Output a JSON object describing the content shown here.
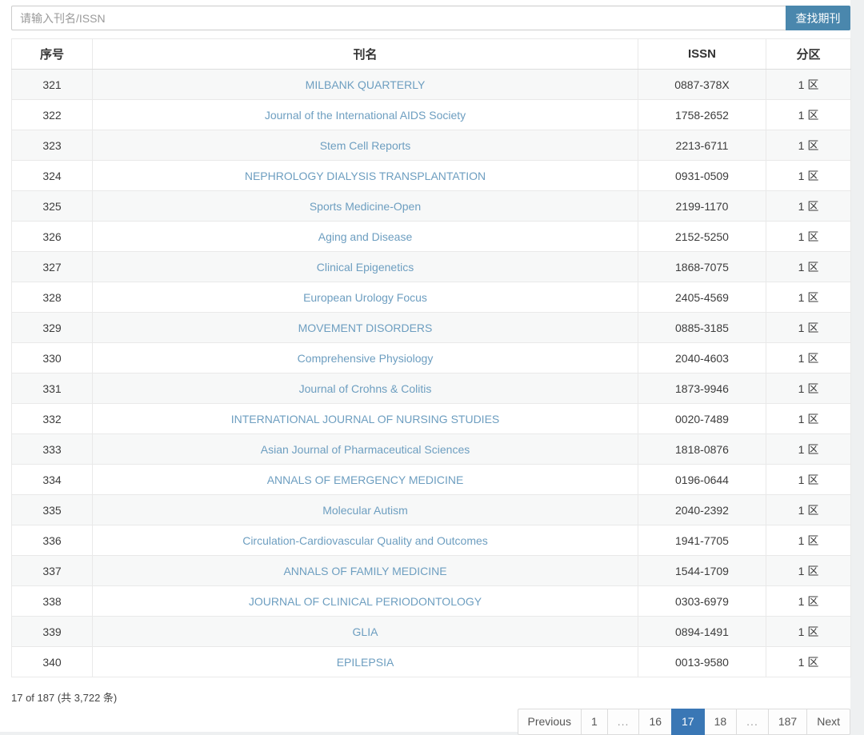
{
  "search": {
    "placeholder": "请输入刊名/ISSN",
    "value": "",
    "button_label": "查找期刊"
  },
  "table": {
    "headers": [
      "序号",
      "刊名",
      "ISSN",
      "分区"
    ],
    "rows": [
      [
        "321",
        "MILBANK QUARTERLY",
        "0887-378X",
        "1 区"
      ],
      [
        "322",
        "Journal of the International AIDS Society",
        "1758-2652",
        "1 区"
      ],
      [
        "323",
        "Stem Cell Reports",
        "2213-6711",
        "1 区"
      ],
      [
        "324",
        "NEPHROLOGY DIALYSIS TRANSPLANTATION",
        "0931-0509",
        "1 区"
      ],
      [
        "325",
        "Sports Medicine-Open",
        "2199-1170",
        "1 区"
      ],
      [
        "326",
        "Aging and Disease",
        "2152-5250",
        "1 区"
      ],
      [
        "327",
        "Clinical Epigenetics",
        "1868-7075",
        "1 区"
      ],
      [
        "328",
        "European Urology Focus",
        "2405-4569",
        "1 区"
      ],
      [
        "329",
        "MOVEMENT DISORDERS",
        "0885-3185",
        "1 区"
      ],
      [
        "330",
        "Comprehensive Physiology",
        "2040-4603",
        "1 区"
      ],
      [
        "331",
        "Journal of Crohns & Colitis",
        "1873-9946",
        "1 区"
      ],
      [
        "332",
        "INTERNATIONAL JOURNAL OF NURSING STUDIES",
        "0020-7489",
        "1 区"
      ],
      [
        "333",
        "Asian Journal of Pharmaceutical Sciences",
        "1818-0876",
        "1 区"
      ],
      [
        "334",
        "ANNALS OF EMERGENCY MEDICINE",
        "0196-0644",
        "1 区"
      ],
      [
        "335",
        "Molecular Autism",
        "2040-2392",
        "1 区"
      ],
      [
        "336",
        "Circulation-Cardiovascular Quality and Outcomes",
        "1941-7705",
        "1 区"
      ],
      [
        "337",
        "ANNALS OF FAMILY MEDICINE",
        "1544-1709",
        "1 区"
      ],
      [
        "338",
        "JOURNAL OF CLINICAL PERIODONTOLOGY",
        "0303-6979",
        "1 区"
      ],
      [
        "339",
        "GLIA",
        "0894-1491",
        "1 区"
      ],
      [
        "340",
        "EPILEPSIA",
        "0013-9580",
        "1 区"
      ]
    ]
  },
  "footer": {
    "summary": "17 of 187 (共 3,722 条)"
  },
  "pagination": {
    "items": [
      {
        "label": "Previous",
        "kind": "prev"
      },
      {
        "label": "1",
        "kind": "page"
      },
      {
        "label": "...",
        "kind": "ellipsis"
      },
      {
        "label": "16",
        "kind": "page"
      },
      {
        "label": "17",
        "kind": "page",
        "active": true
      },
      {
        "label": "18",
        "kind": "page"
      },
      {
        "label": "...",
        "kind": "ellipsis"
      },
      {
        "label": "187",
        "kind": "page"
      },
      {
        "label": "Next",
        "kind": "next"
      }
    ]
  },
  "colors": {
    "search_button": "#4a87ad",
    "active_page": "#3a77b5",
    "link": "#6d9ec0",
    "row_stripe": "#f7f8f8"
  }
}
